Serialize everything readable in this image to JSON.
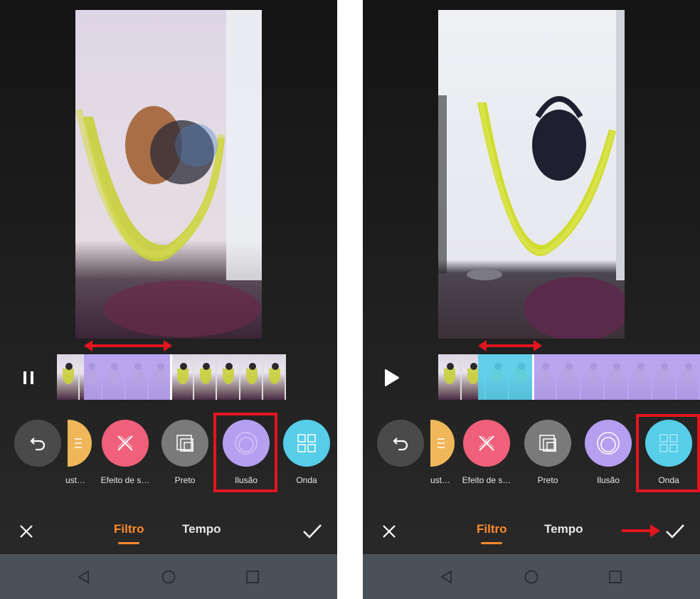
{
  "colors": {
    "accent": "#ff8a2b",
    "highlight": "#e3151f",
    "ilusao": "#b59ff0",
    "onda": "#56cde9",
    "efeito": "#f0607a",
    "preto": "#7a7a7a",
    "yellow": "#f0b75a"
  },
  "screens": [
    {
      "playback": {
        "icon": "pause-icon"
      },
      "filters": [
        {
          "label": "ust…",
          "icon": "yellow-filter-icon"
        },
        {
          "label": "Efeito de s…",
          "icon": "x-cross-icon"
        },
        {
          "label": "Preto",
          "icon": "stacked-squares-icon"
        },
        {
          "label": "Ilusão",
          "icon": "concentric-circles-icon"
        },
        {
          "label": "Onda",
          "icon": "grid-squares-icon"
        }
      ],
      "selected_filter": "Ilusão",
      "tabs": [
        {
          "label": "Filtro",
          "active": true
        },
        {
          "label": "Tempo",
          "active": false
        }
      ],
      "actions": {
        "cancel": "close-icon",
        "confirm": "check-icon"
      }
    },
    {
      "playback": {
        "icon": "play-icon"
      },
      "filters": [
        {
          "label": "ust…",
          "icon": "yellow-filter-icon"
        },
        {
          "label": "Efeito de s…",
          "icon": "x-cross-icon"
        },
        {
          "label": "Preto",
          "icon": "stacked-squares-icon"
        },
        {
          "label": "Ilusão",
          "icon": "concentric-circles-icon"
        },
        {
          "label": "Onda",
          "icon": "grid-squares-icon"
        }
      ],
      "selected_filter": "Onda",
      "tabs": [
        {
          "label": "Filtro",
          "active": true
        },
        {
          "label": "Tempo",
          "active": false
        }
      ],
      "actions": {
        "cancel": "close-icon",
        "confirm": "check-icon"
      }
    }
  ],
  "navbar": [
    "back-icon",
    "home-icon",
    "recents-icon"
  ]
}
